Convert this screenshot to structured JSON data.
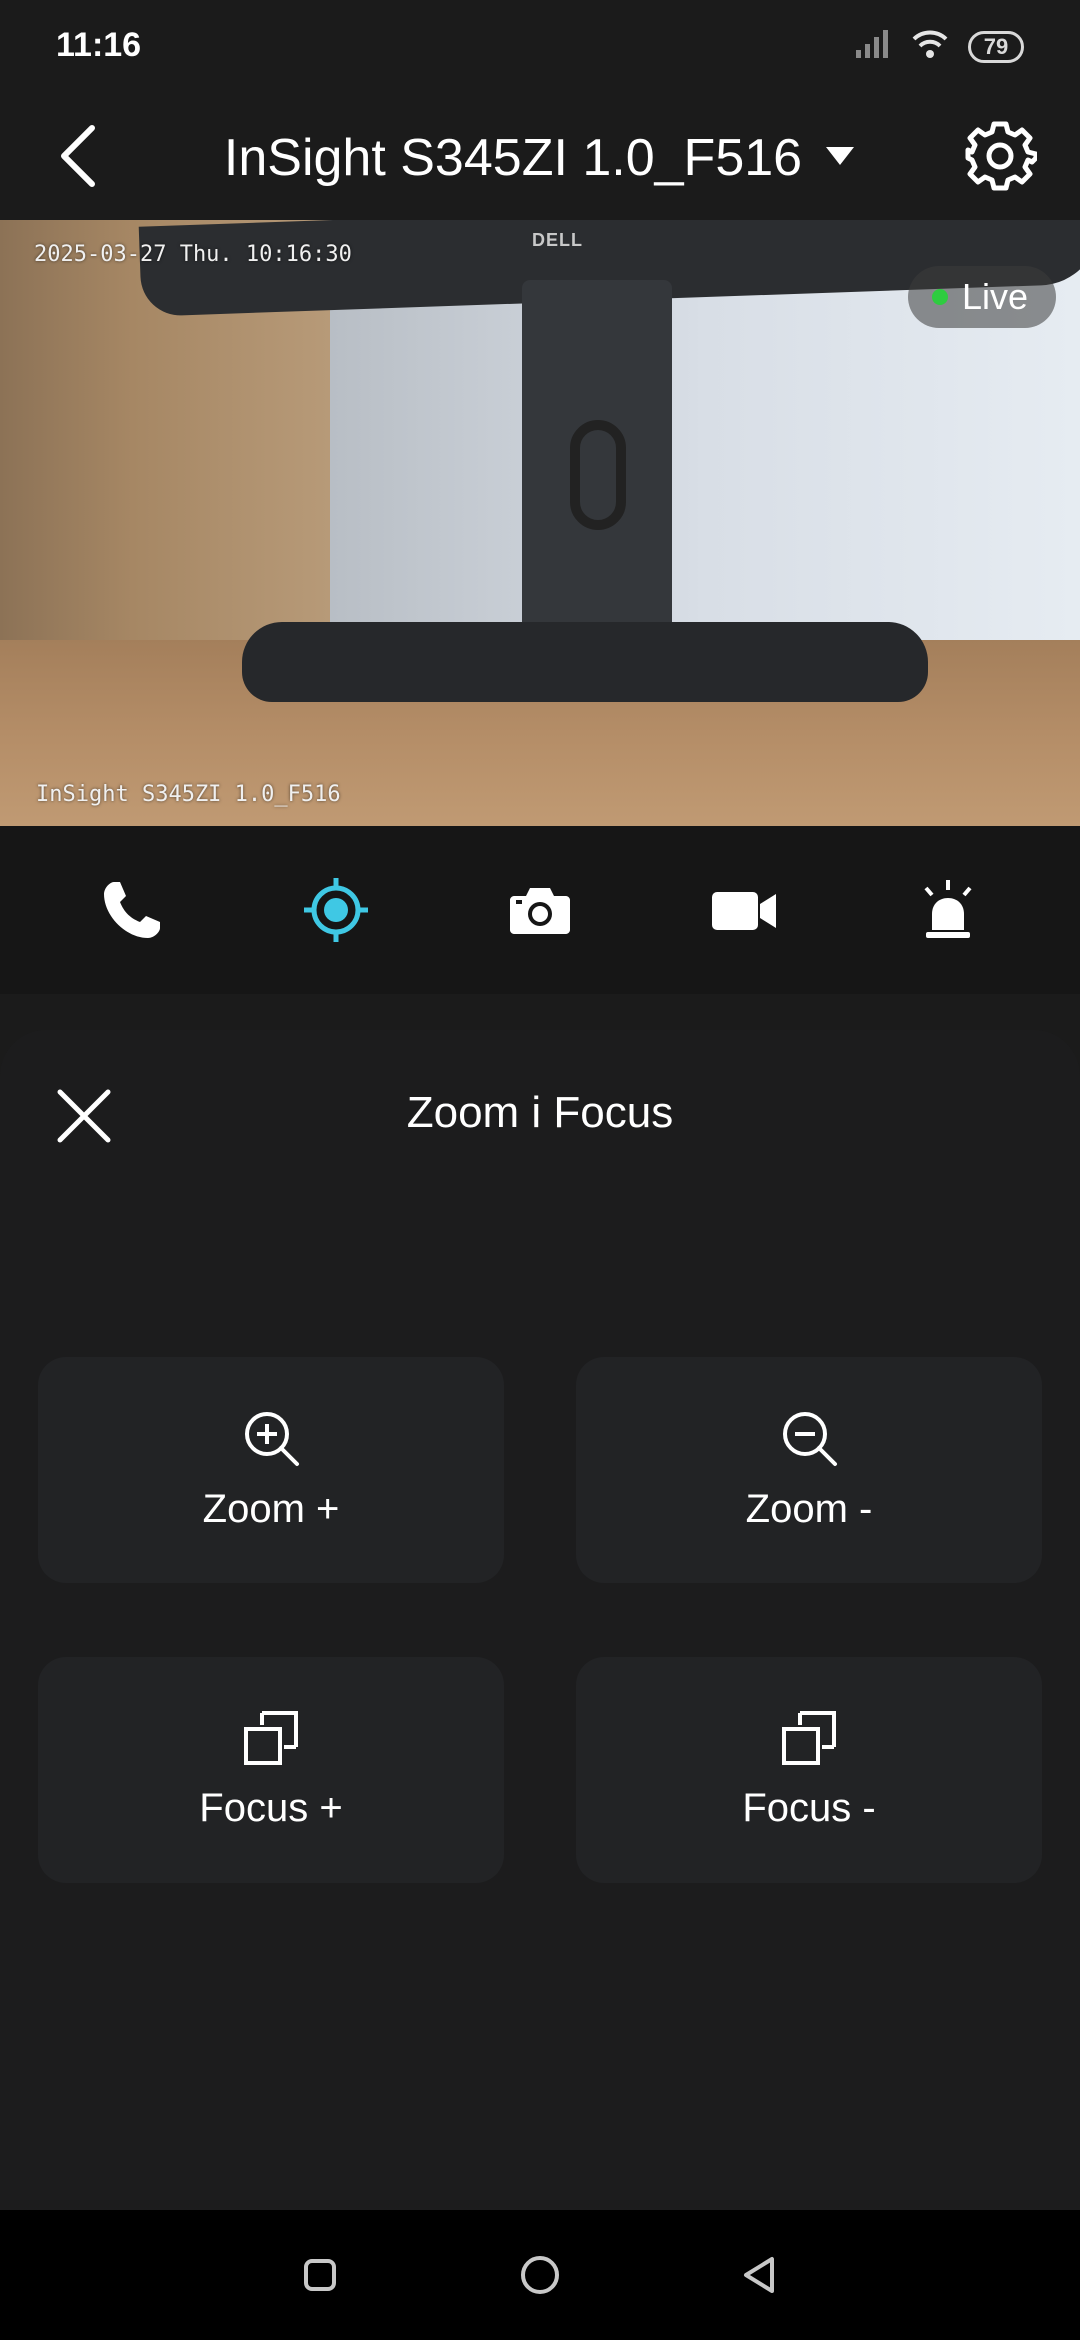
{
  "status_bar": {
    "time": "11:16",
    "battery": "79"
  },
  "header": {
    "device_name": "InSight S345ZI 1.0_F516"
  },
  "camera": {
    "timestamp": "2025-03-27 Thu. 10:16:30",
    "overlay_name": "InSight S345ZI 1.0_F516",
    "live_label": "Live",
    "monitor_brand": "DELL"
  },
  "toolbar": {
    "items": [
      {
        "icon": "phone-icon"
      },
      {
        "icon": "ptz-target-icon",
        "active": true,
        "color": "#3fc8e4"
      },
      {
        "icon": "camera-snapshot-icon"
      },
      {
        "icon": "video-record-icon"
      },
      {
        "icon": "siren-icon"
      }
    ]
  },
  "panel": {
    "title": "Zoom i Focus",
    "controls": [
      {
        "label": "Zoom +",
        "icon": "zoom-in-icon"
      },
      {
        "label": "Zoom -",
        "icon": "zoom-out-icon"
      },
      {
        "label": "Focus +",
        "icon": "focus-in-icon"
      },
      {
        "label": "Focus -",
        "icon": "focus-out-icon"
      }
    ]
  },
  "colors": {
    "background": "#1b1b1b",
    "panel": "#1c1c1d",
    "card": "#222325",
    "accent": "#3fc8e4",
    "live_dot": "#2ecc40"
  }
}
